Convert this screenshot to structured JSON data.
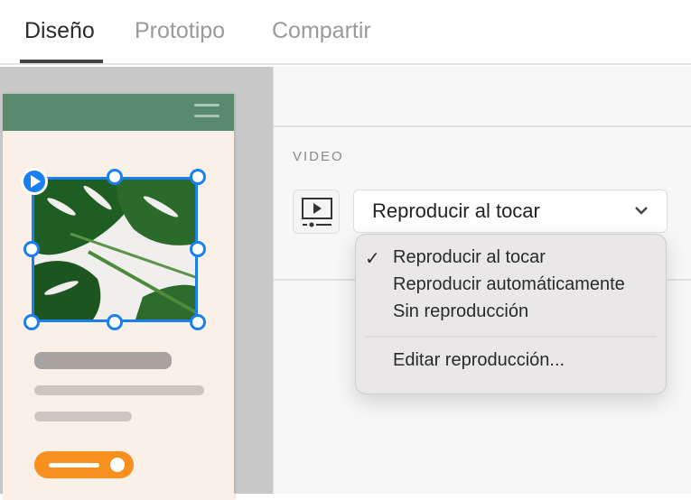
{
  "tabs": [
    {
      "label": "Diseño",
      "active": true
    },
    {
      "label": "Prototipo"
    },
    {
      "label": "Compartir"
    }
  ],
  "panel": {
    "section_label": "VIDEO",
    "playback_select": {
      "value": "Reproducir al tocar",
      "icon": "video-playback-icon"
    },
    "menu": {
      "items": [
        "Reproducir al tocar",
        "Reproducir automáticamente",
        "Sin reproducción"
      ],
      "selected": "Reproducir al tocar",
      "edit_item": "Editar reproducción..."
    }
  },
  "colors": {
    "accent": "#1a7ff0",
    "header_green": "#5a8a6e",
    "artboard_bg": "#faf0e8",
    "button_orange": "#f7901e"
  }
}
